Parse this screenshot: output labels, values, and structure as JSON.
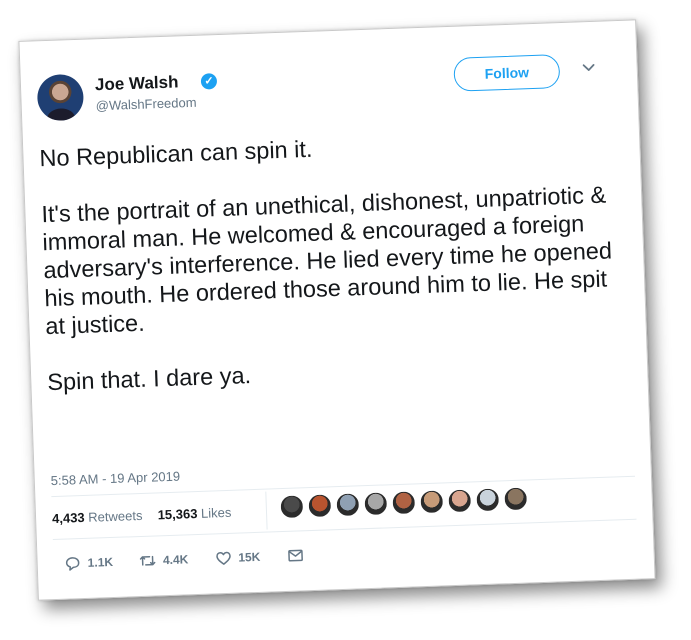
{
  "tweet": {
    "author": {
      "name": "Joe Walsh",
      "handle": "@WalshFreedom",
      "verified_icon": "verified-badge-icon",
      "verified_glyph": "✓"
    },
    "follow_label": "Follow",
    "paragraphs": [
      "No Republican can spin it.",
      "It's the portrait of an unethical, dishonest, unpatriotic & immoral man. He welcomed & encouraged a foreign adversary's interference. He lied every time he opened his mouth. He ordered those around him to lie. He spit at justice.",
      "Spin that. I dare ya."
    ],
    "timestamp": "5:58 AM - 19 Apr 2019",
    "stats": {
      "retweets_count": "4,433",
      "retweets_label": "Retweets",
      "likes_count": "15,363",
      "likes_label": "Likes"
    },
    "actions": {
      "reply_count": "1.1K",
      "retweet_count": "4.4K",
      "like_count": "15K"
    },
    "liker_avatars": [
      "#4a4a4a",
      "#b9542f",
      "#8fa0b3",
      "#a7a7a7",
      "#b06243",
      "#c79b78",
      "#d8a58f",
      "#c9d3dc",
      "#8a7560"
    ],
    "colors": {
      "accent": "#1da1f2",
      "text": "#14171a",
      "secondary_text": "#657786",
      "divider": "#e6ecf0"
    }
  }
}
